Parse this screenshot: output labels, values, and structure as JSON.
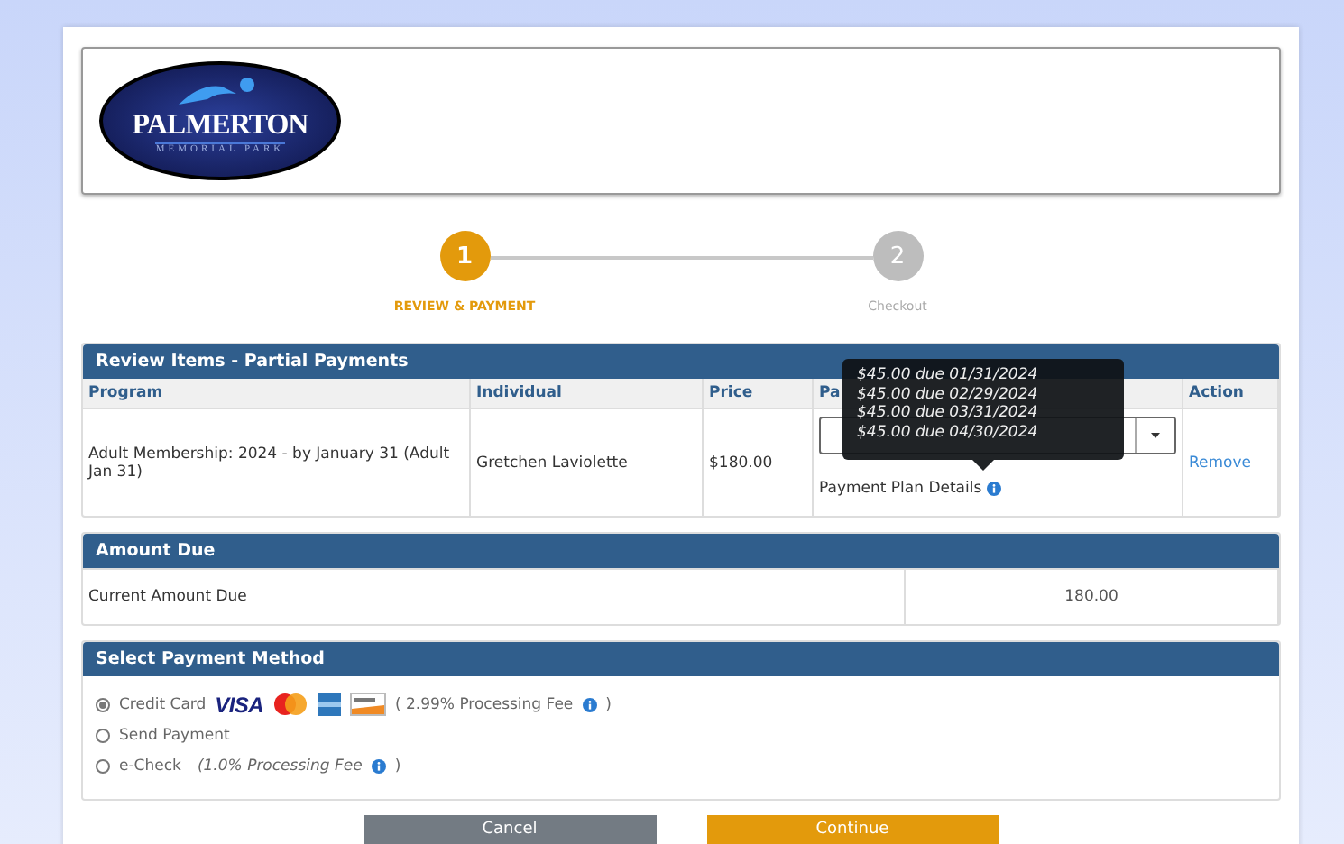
{
  "logo": {
    "name": "PALMERTON",
    "subtitle": "MEMORIAL PARK"
  },
  "steps": [
    {
      "number": "1",
      "label": "REVIEW & PAYMENT",
      "selected": true
    },
    {
      "number": "2",
      "label": "Checkout",
      "selected": false
    }
  ],
  "review": {
    "title": "Review Items - Partial Payments",
    "columns": [
      "Program",
      "Individual",
      "Price",
      "Pa",
      "Action"
    ],
    "rows": [
      {
        "program": "Adult Membership: 2024 - by January 31 (Adult Jan 31)",
        "individual": "Gretchen Laviolette",
        "price": "$180.00",
        "plan_link": "Payment Plan Details",
        "action": "Remove"
      }
    ],
    "tooltip": [
      "$45.00 due 01/31/2024",
      "$45.00 due 02/29/2024",
      "$45.00 due 03/31/2024",
      "$45.00 due 04/30/2024"
    ]
  },
  "amount_due": {
    "title": "Amount Due",
    "label": "Current Amount Due",
    "value": "180.00"
  },
  "payment_method": {
    "title": "Select Payment Method",
    "options": [
      {
        "kind": "card",
        "label": "Credit Card",
        "brand": "VISA",
        "fee": "( 2.99% Processing Fee",
        "close": ")",
        "selected": true
      },
      {
        "kind": "plain",
        "label": "Send Payment",
        "selected": false
      },
      {
        "kind": "fee",
        "label": "e-Check",
        "fee": "(1.0% Processing Fee",
        "close": ")",
        "selected": false
      }
    ]
  },
  "buttons": [
    {
      "label": "Cancel",
      "kind": "secondary"
    },
    {
      "label": "Continue",
      "kind": "primary"
    }
  ]
}
